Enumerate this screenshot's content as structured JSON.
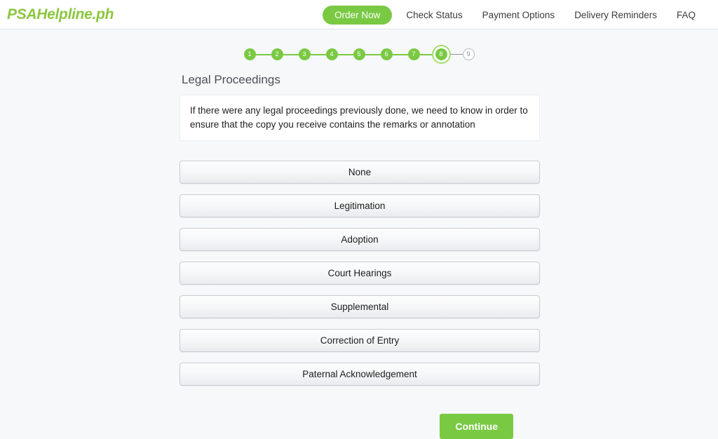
{
  "header": {
    "logo": "PSAHelpline.ph",
    "nav": [
      {
        "label": "Order Now",
        "style": "pill"
      },
      {
        "label": "Check Status",
        "style": "link"
      },
      {
        "label": "Payment Options",
        "style": "link"
      },
      {
        "label": "Delivery Reminders",
        "style": "link"
      },
      {
        "label": "FAQ",
        "style": "link"
      }
    ]
  },
  "progress": {
    "steps": [
      {
        "number": "1",
        "state": "done"
      },
      {
        "number": "2",
        "state": "done"
      },
      {
        "number": "3",
        "state": "done"
      },
      {
        "number": "4",
        "state": "done"
      },
      {
        "number": "5",
        "state": "done"
      },
      {
        "number": "6",
        "state": "done"
      },
      {
        "number": "7",
        "state": "done"
      },
      {
        "number": "8",
        "state": "current"
      },
      {
        "number": "9",
        "state": "pending"
      }
    ],
    "current_step": 8,
    "total_steps": 9
  },
  "main": {
    "title": "Legal Proceedings",
    "info_text": "If there were any legal proceedings previously done, we need to know in order to ensure that the copy you receive contains the remarks or annotation",
    "options": [
      {
        "label": "None"
      },
      {
        "label": "Legitimation"
      },
      {
        "label": "Adoption"
      },
      {
        "label": "Court Hearings"
      },
      {
        "label": "Supplemental"
      },
      {
        "label": "Correction of Entry"
      },
      {
        "label": "Paternal Acknowledgement"
      }
    ],
    "continue_label": "Continue"
  },
  "colors": {
    "brand_green": "#7ac943",
    "logo_green": "#8cc63e",
    "page_background": "#f7f8fa",
    "header_background": "#ffffff",
    "title_text": "#4b5057",
    "pending_step": "#9094a0"
  }
}
